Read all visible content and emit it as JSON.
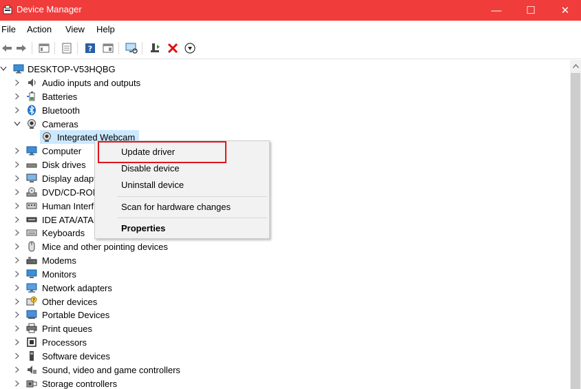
{
  "window": {
    "title": "Device Manager",
    "minimize": "—",
    "maximize": "☐",
    "close": "✕"
  },
  "menu": [
    "File",
    "Action",
    "View",
    "Help"
  ],
  "toolbar": {
    "icons": [
      "back-icon",
      "forward-icon",
      "show-hide-tree-icon",
      "properties-icon",
      "help-icon",
      "view-icon",
      "scan-hardware-icon",
      "update-driver-icon",
      "uninstall-icon",
      "disable-icon"
    ]
  },
  "tree": {
    "root": "DESKTOP-V53HQBG",
    "items": [
      {
        "label": "Audio inputs and outputs",
        "icon": "speaker-icon"
      },
      {
        "label": "Batteries",
        "icon": "battery-icon"
      },
      {
        "label": "Bluetooth",
        "icon": "bluetooth-icon"
      },
      {
        "label": "Cameras",
        "icon": "camera-icon",
        "expanded": true
      },
      {
        "label": "Integrated Webcam",
        "icon": "webcam-icon",
        "child": true,
        "selected": true
      },
      {
        "label": "Computer",
        "icon": "computer-icon"
      },
      {
        "label": "Disk drives",
        "icon": "disk-icon"
      },
      {
        "label": "Display adapt",
        "icon": "display-icon"
      },
      {
        "label": "DVD/CD-ROM",
        "icon": "dvd-icon"
      },
      {
        "label": "Human Interf",
        "icon": "hid-icon"
      },
      {
        "label": "IDE ATA/ATAP",
        "icon": "ide-icon"
      },
      {
        "label": "Keyboards",
        "icon": "keyboard-icon"
      },
      {
        "label": "Mice and other pointing devices",
        "icon": "mouse-icon"
      },
      {
        "label": "Modems",
        "icon": "modem-icon"
      },
      {
        "label": "Monitors",
        "icon": "monitor-icon"
      },
      {
        "label": "Network adapters",
        "icon": "network-icon"
      },
      {
        "label": "Other devices",
        "icon": "unknown-device-icon"
      },
      {
        "label": "Portable Devices",
        "icon": "portable-icon"
      },
      {
        "label": "Print queues",
        "icon": "printer-icon"
      },
      {
        "label": "Processors",
        "icon": "processor-icon"
      },
      {
        "label": "Software devices",
        "icon": "software-device-icon"
      },
      {
        "label": "Sound, video and game controllers",
        "icon": "sound-icon"
      },
      {
        "label": "Storage controllers",
        "icon": "storage-icon"
      }
    ]
  },
  "context_menu": {
    "update": "Update driver",
    "disable": "Disable device",
    "uninstall": "Uninstall device",
    "scan": "Scan for hardware changes",
    "properties": "Properties"
  },
  "colors": {
    "titlebar": "#f13c3c",
    "selection": "#cce8ff",
    "highlight_box": "#e0141e"
  }
}
